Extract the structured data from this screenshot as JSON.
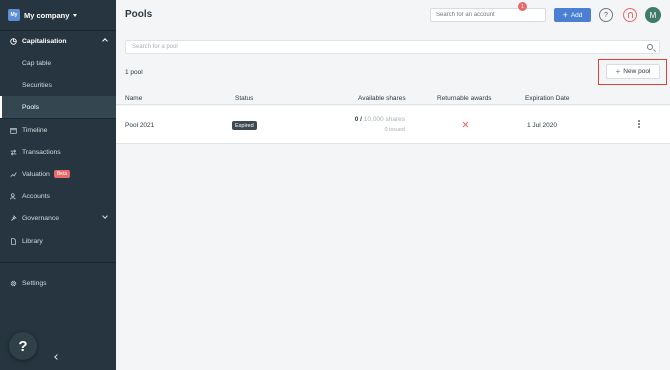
{
  "company": {
    "logo": "My",
    "name": "My company"
  },
  "sidebar": {
    "items": [
      {
        "label": "Capitalisation",
        "icon": "pie-chart-icon"
      },
      {
        "label": "Cap table"
      },
      {
        "label": "Securities"
      },
      {
        "label": "Pools"
      },
      {
        "label": "Timeline",
        "icon": "calendar-icon"
      },
      {
        "label": "Transactions",
        "icon": "arrows-icon"
      },
      {
        "label": "Valuation",
        "icon": "trend-icon",
        "badge": "Beta"
      },
      {
        "label": "Accounts",
        "icon": "users-icon"
      },
      {
        "label": "Governance",
        "icon": "gavel-icon"
      },
      {
        "label": "Library",
        "icon": "document-icon"
      },
      {
        "label": "Settings",
        "icon": "gear-icon"
      }
    ],
    "help_label": "?"
  },
  "header": {
    "title": "Pools",
    "account_search_placeholder": "Search for an account",
    "add_label": "Add",
    "help_label": "?",
    "notification_count": "1",
    "avatar_initial": "M"
  },
  "main": {
    "pool_search_placeholder": "Search for a pool",
    "pool_count": "1 pool",
    "new_pool_label": "New pool",
    "columns": [
      "Name",
      "Status",
      "Available shares",
      "Returnable awards",
      "Expiration Date"
    ],
    "rows": [
      {
        "name": "Pool 2021",
        "status": "Expired",
        "available": "0 /",
        "total": "10,000 shares",
        "issued": "0 issued",
        "returnable": "x-icon",
        "expiration": "1 Jul 2020"
      }
    ]
  },
  "colors": {
    "sidebar": "#26353f",
    "accent": "#4a7fd4",
    "alert": "#e46b6b",
    "highlight": "#d9413a"
  }
}
